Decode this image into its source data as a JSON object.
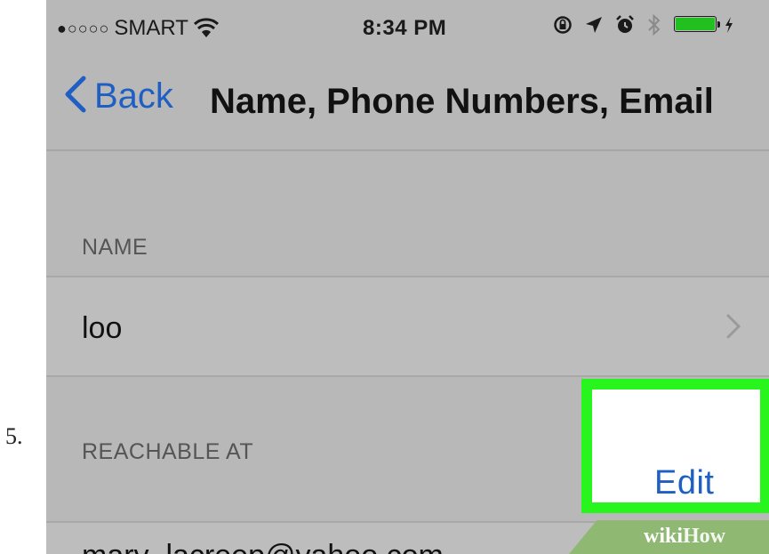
{
  "step": {
    "number": "5."
  },
  "status_bar": {
    "signal": "●○○○○",
    "carrier": "SMART",
    "time": "8:34 PM",
    "icons": [
      "wifi-icon",
      "rotation-lock-icon",
      "location-icon",
      "alarm-icon",
      "bluetooth-icon",
      "battery-icon",
      "charging-icon"
    ],
    "battery_level": 1.0
  },
  "nav": {
    "back_label": "Back",
    "title": "Name, Phone Numbers, Email"
  },
  "sections": {
    "name_header": "NAME",
    "name_value": "loo",
    "reachable_header": "REACHABLE AT",
    "edit_label": "Edit",
    "email_value": "mary_lacreep@yahoo.com"
  },
  "watermark": {
    "part1": "wiki",
    "part2": "How"
  },
  "colors": {
    "accent_blue": "#1f5fc4",
    "highlight_green": "#27f51d",
    "battery_green": "#22c01e",
    "overlay_gray": "#b8b8b8"
  }
}
